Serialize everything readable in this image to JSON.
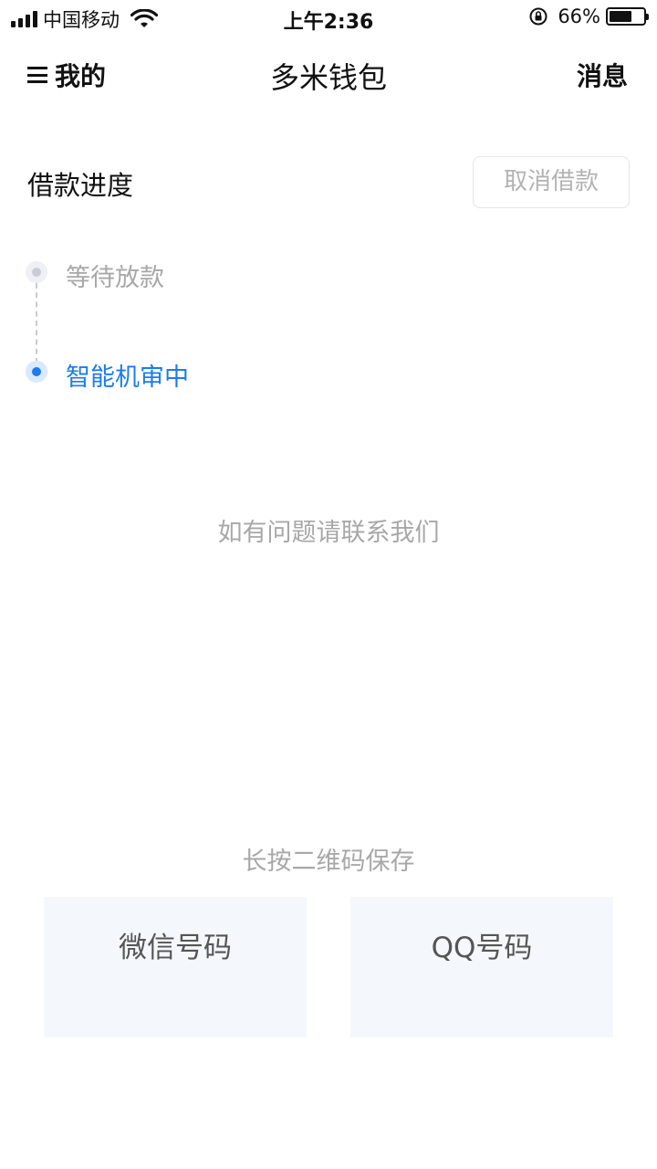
{
  "status_bar": {
    "carrier": "中国移动",
    "time": "上午2:36",
    "battery_percent": "66%",
    "battery_level": 0.66,
    "icons": [
      "signal-icon",
      "wifi-icon",
      "rotation-lock-icon",
      "battery-icon"
    ]
  },
  "nav": {
    "left_label": "我的",
    "title": "多米钱包",
    "right_label": "消息"
  },
  "progress": {
    "title": "借款进度",
    "cancel_label": "取消借款",
    "steps": [
      {
        "label": "等待放款",
        "state": "inactive"
      },
      {
        "label": "智能机审中",
        "state": "active"
      }
    ]
  },
  "contact": {
    "hint": "如有问题请联系我们",
    "qr_hint": "长按二维码保存",
    "cards": [
      {
        "label": "微信号码"
      },
      {
        "label": "QQ号码"
      }
    ]
  },
  "colors": {
    "accent": "#1a7cf0",
    "muted_text": "#a8a8a8",
    "card_bg": "#f4f8fc"
  }
}
